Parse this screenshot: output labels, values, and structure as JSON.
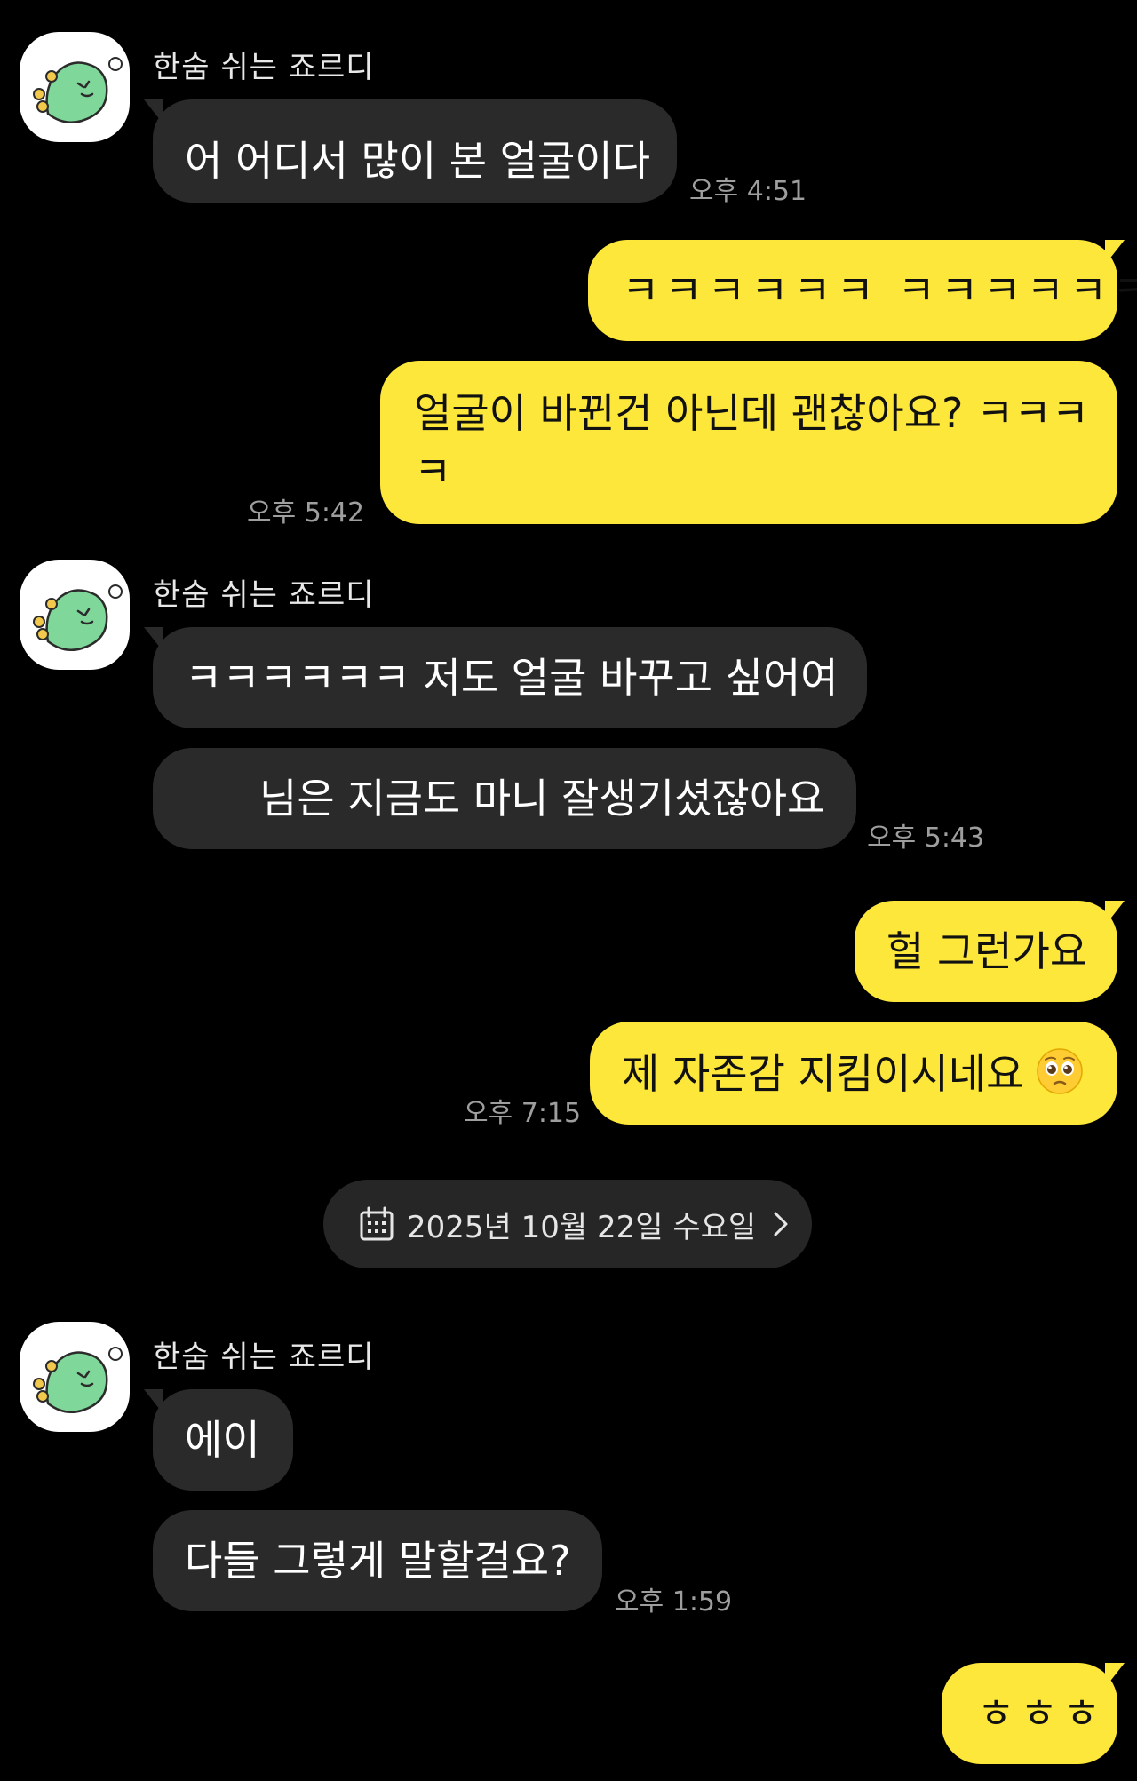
{
  "chat": {
    "partner_name": "한숨 쉬는 죠르디",
    "groups": [
      {
        "sender": "한숨 쉬는 죠르디",
        "messages": [
          "어 어디서 많이 본 얼굴이다"
        ],
        "time": "오후 4:51"
      },
      {
        "sender": "me",
        "messages": [
          "ㅋㅋㅋㅋㅋㅋ ㅋㅋㅋㅋㅋㅋ",
          "얼굴이 바뀐건 아닌데 괜찮아요? ㅋㅋㅋ",
          "ㅋ"
        ],
        "time": "오후 5:42"
      },
      {
        "sender": "한숨 쉬는 죠르디",
        "messages": [
          "ㅋㅋㅋㅋㅋㅋ 저도 얼굴 바꾸고 싶어여",
          "님은 지금도 마니 잘생기셨잖아요"
        ],
        "time": "오후 5:43"
      },
      {
        "sender": "me",
        "messages": [
          "헐 그런가요",
          "제 자존감 지킴이시네요"
        ],
        "emoji": "pleading-face-emoji",
        "time": "오후 7:15"
      },
      {
        "divider": "2025년 10월 22일 수요일"
      },
      {
        "sender": "한숨 쉬는 죠르디",
        "messages": [
          "에이",
          "다들 그렇게 말할걸요?"
        ],
        "time": "오후 1:59"
      },
      {
        "sender": "me",
        "messages": [
          "ㅎㅎㅎ"
        ]
      }
    ]
  },
  "colors": {
    "background": "#000000",
    "incoming_bubble": "#2a2a2a",
    "outgoing_bubble": "#fde73a",
    "timestamp": "#9e9e9e",
    "avatar_character": "#7fd79a"
  },
  "icons": {
    "avatar": "jordy-dinosaur-avatar",
    "date_divider_icon": "calendar-icon",
    "date_divider_chevron": "chevron-right-icon"
  }
}
